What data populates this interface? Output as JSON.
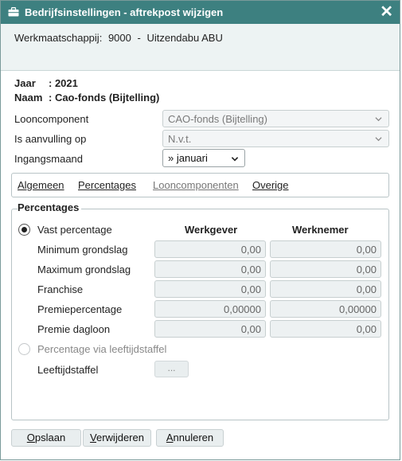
{
  "window": {
    "title": "Bedrijfsinstellingen - aftrekpost wijzigen",
    "close_icon": "close-icon",
    "title_icon": "briefcase-icon",
    "title_bg": "#3d8080"
  },
  "company": {
    "label": "Werkmaatschappij:",
    "code": "9000",
    "name": "Uitzendabu ABU"
  },
  "info": {
    "year_label": "Jaar",
    "year_value": ": 2021",
    "name_label": "Naam",
    "name_value": ": Cao-fonds (Bijtelling)"
  },
  "form": {
    "looncomponent_label": "Looncomponent",
    "looncomponent_value": "CAO-fonds (Bijtelling)",
    "aanvulling_label": "Is aanvulling op",
    "aanvulling_value": "N.v.t.",
    "ingangsmaand_label": "Ingangsmaand",
    "ingangsmaand_value": "» januari"
  },
  "tabs": [
    {
      "label": "Algemeen",
      "enabled": true
    },
    {
      "label": "Percentages",
      "enabled": true
    },
    {
      "label": "Looncomponenten",
      "enabled": false
    },
    {
      "label": "Overige",
      "enabled": true
    }
  ],
  "percentages": {
    "section_title": "Percentages",
    "vast_label": "Vast percentage",
    "vast_selected": true,
    "col_werkgever": "Werkgever",
    "col_werknemer": "Werknemer",
    "rows": [
      {
        "label": "Minimum grondslag",
        "werkgever": "0,00",
        "werknemer": "0,00"
      },
      {
        "label": "Maximum grondslag",
        "werkgever": "0,00",
        "werknemer": "0,00"
      },
      {
        "label": "Franchise",
        "werkgever": "0,00",
        "werknemer": "0,00"
      },
      {
        "label": "Premiepercentage",
        "werkgever": "0,00000",
        "werknemer": "0,00000"
      },
      {
        "label": "Premie dagloon",
        "werkgever": "0,00",
        "werknemer": "0,00"
      }
    ],
    "leeftijd_label": "Percentage via leeftijdstaffel",
    "leeftijd_selected": false,
    "staffel_label": "Leeftijdstaffel",
    "staffel_button": "..."
  },
  "buttons": {
    "save_accel": "O",
    "save_rest": "pslaan",
    "delete_accel": "V",
    "delete_rest": "erwijderen",
    "cancel_accel": "A",
    "cancel_rest": "nnuleren"
  }
}
